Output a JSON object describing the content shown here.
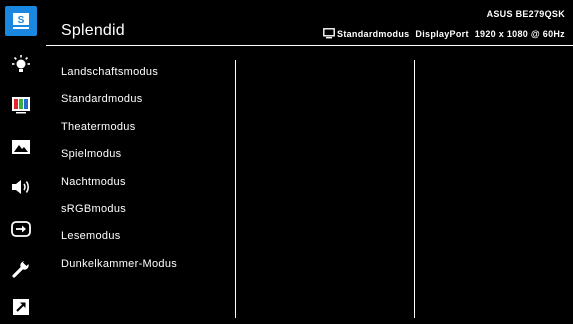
{
  "header": {
    "title": "Splendid",
    "model": "ASUS BE279QSK",
    "mode": "Standardmodus",
    "input": "DisplayPort",
    "resolution": "1920 x 1080 @ 60Hz"
  },
  "modes": [
    "Landschaftsmodus",
    "Standardmodus",
    "Theatermodus",
    "Spielmodus",
    "Nachtmodus",
    "sRGBmodus",
    "Lesemodus",
    "Dunkelkammer-Modus"
  ],
  "sidebar": {
    "active_item": "splendid",
    "items": [
      "splendid-icon",
      "bluelight-icon",
      "color-icon",
      "image-icon",
      "sound-icon",
      "input-icon",
      "system-settings-icon",
      "shortcut-icon"
    ],
    "accent_color": "#1a88e0"
  }
}
